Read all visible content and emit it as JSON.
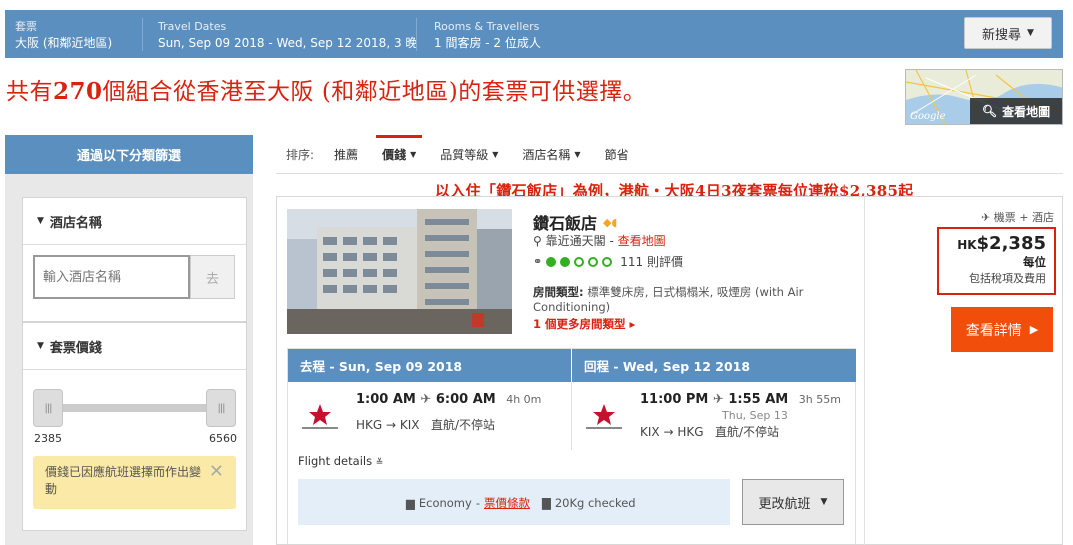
{
  "topbar": {
    "destination_label": "套票",
    "destination": "大阪 (和鄰近地區)",
    "dates_label": "Travel Dates",
    "dates": "Sun, Sep 09 2018 - Wed, Sep 12 2018, 3 晚",
    "rooms_label": "Rooms & Travellers",
    "rooms": "1 間客房 - 2 位成人",
    "new_search": "新搜尋"
  },
  "headline": {
    "prefix": "共有",
    "count": "270",
    "suffix": "個組合從香港至大阪 (和鄰近地區)的套票可供選擇。"
  },
  "map": {
    "button": "查看地圖",
    "brand": "Google"
  },
  "sidebar": {
    "title": "通過以下分類篩選",
    "hotel_filter": {
      "title": "酒店名稱",
      "placeholder": "輸入酒店名稱",
      "go": "去"
    },
    "price_filter": {
      "title": "套票價錢",
      "min": "2385",
      "max": "6560",
      "notice": "價錢已因應航班選擇而作出變動"
    }
  },
  "sort": {
    "label": "排序:",
    "items": [
      {
        "label": "推薦",
        "caret": false
      },
      {
        "label": "價錢",
        "caret": true
      },
      {
        "label": "品質等級",
        "caret": true
      },
      {
        "label": "酒店名稱",
        "caret": true
      },
      {
        "label": "節省",
        "caret": false
      }
    ]
  },
  "promo": "以入住「鑽石飯店」為例，港航‧大阪4日3夜套票每位連稅$2,385起",
  "result": {
    "hotel_name": "鑽石飯店",
    "location": "靠近通天閣",
    "map_link": "查看地圖",
    "review_count": "111 則評價",
    "rating_dots": 5,
    "room_label": "房間類型:",
    "room_desc": "標準雙床房, 日式榻榻米, 吸煙房 (with Air Conditioning)",
    "more_rooms": "1 個更多房間類型",
    "package_type": "機票 + 酒店",
    "price_currency": "HK",
    "price": "$2,385",
    "per": "每位",
    "includes": "包括稅項及費用",
    "detail_button": "查看詳情",
    "outbound": {
      "header": "去程 - Sun, Sep 09 2018",
      "depart": "1:00 AM",
      "arrive": "6:00 AM",
      "duration": "4h 0m",
      "route": "HKG → KIX",
      "stops": "直航/不停站",
      "next_day": ""
    },
    "inbound": {
      "header": "回程 - Wed, Sep 12 2018",
      "depart": "11:00 PM",
      "arrive": "1:55 AM",
      "duration": "3h 55m",
      "route": "KIX → HKG",
      "stops": "直航/不停站",
      "next_day": "Thu, Sep 13"
    },
    "flight_details": "Flight details",
    "cabin": "Economy",
    "fare_rules": "票價條款",
    "baggage": "20Kg checked",
    "change_flight": "更改航班"
  }
}
